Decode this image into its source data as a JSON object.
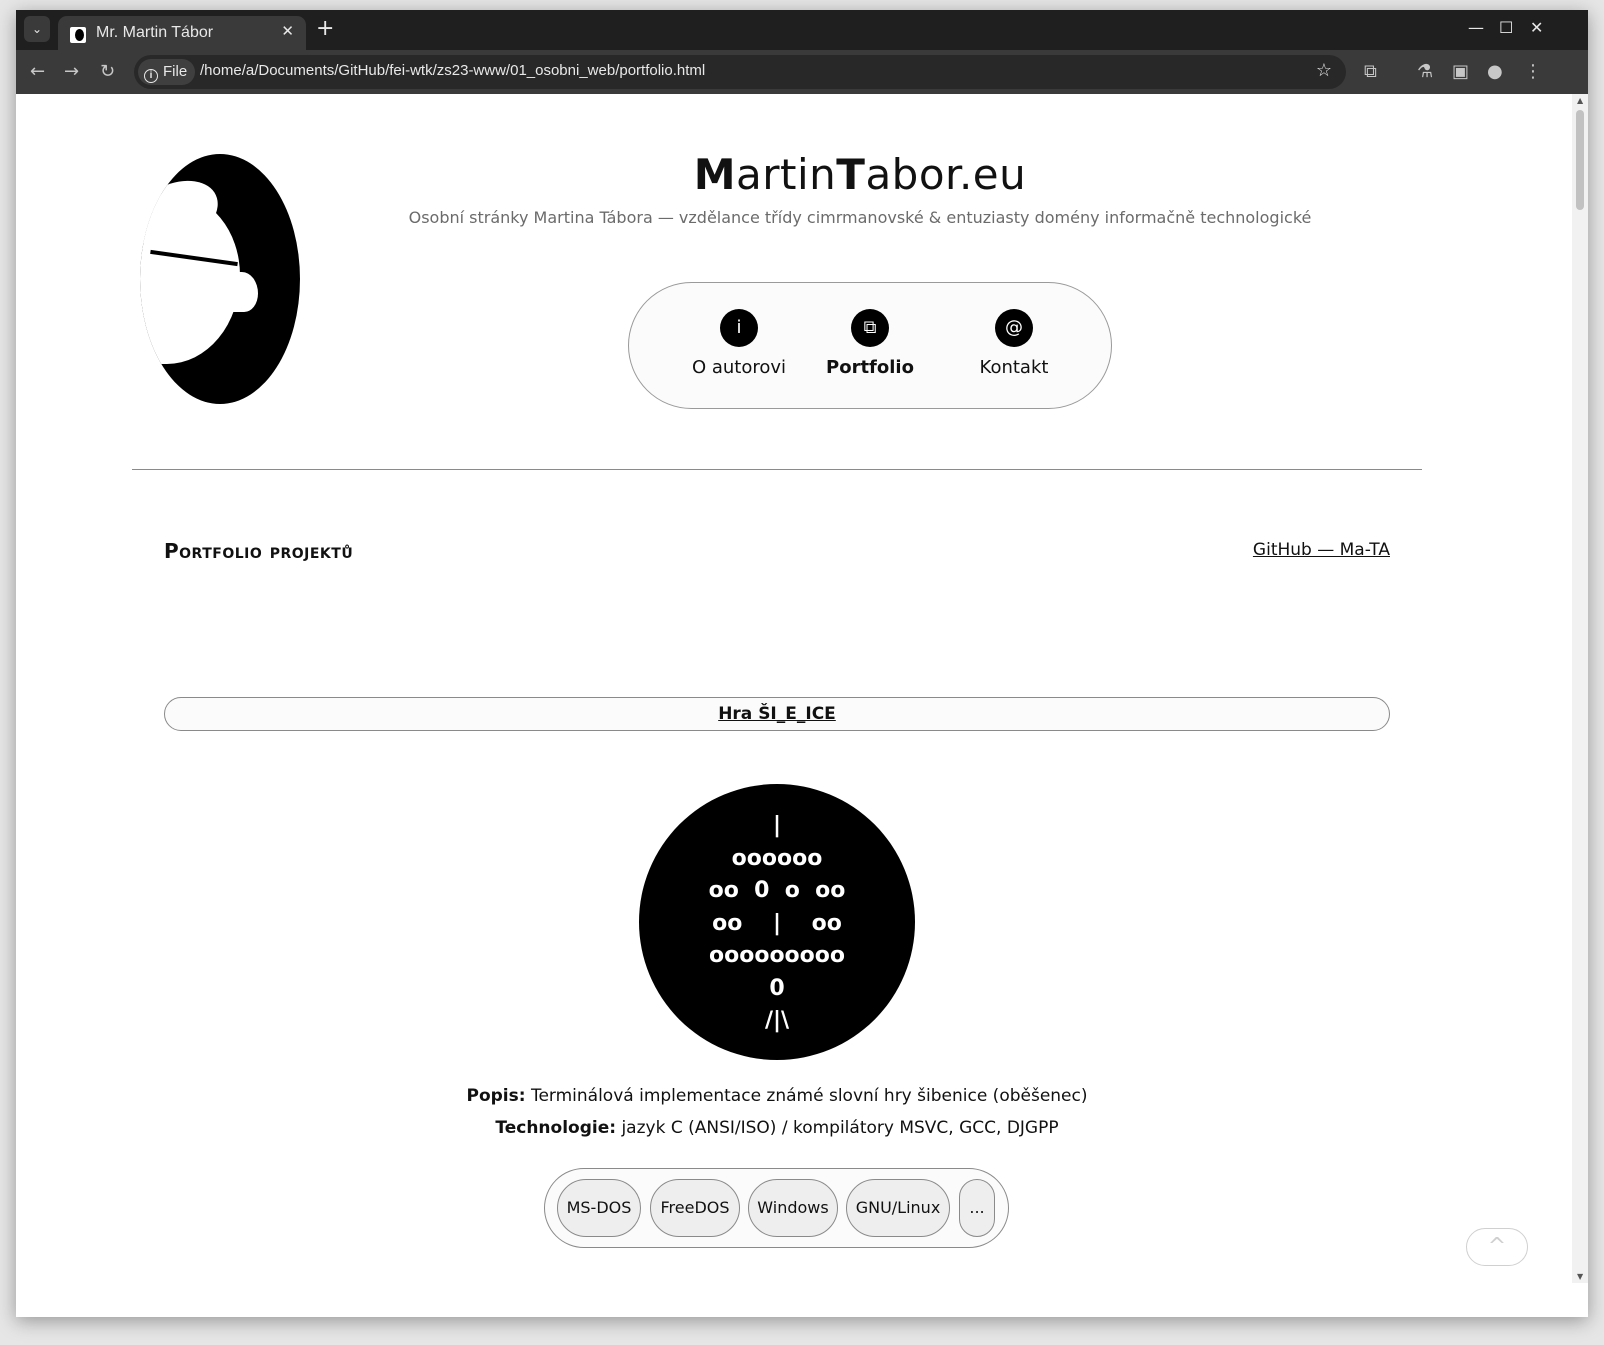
{
  "browser": {
    "tab_title": "Mr. Martin Tábor",
    "new_tab": "+",
    "close_tab": "✕",
    "tab_search": "⌄",
    "window_controls": {
      "minimize": "—",
      "maximize": "☐",
      "close": "✕"
    },
    "omnibox": {
      "chip_icon": "i",
      "chip_label": "File",
      "url": "/home/a/Documents/GitHub/fei-wtk/zs23-www/01_osobni_web/portfolio.html"
    },
    "toolbar_icons": {
      "back": "←",
      "forward": "→",
      "reload": "↻",
      "bookmark": "☆",
      "extensions": "⧉",
      "labs": "⚗",
      "sidepanel": "▣",
      "profile": "●",
      "menu": "⋮"
    }
  },
  "header": {
    "title_part1_bold": "M",
    "title_part1_rest": "artin",
    "title_part2_bold": "T",
    "title_part2_rest": "abor.eu",
    "subtitle": "Osobní stránky Martina Tábora — vzdělance třídy cimrmanovské & entuziasty domény informačně technologické"
  },
  "nav": {
    "items": [
      {
        "icon": "i",
        "label": "O autorovi",
        "active": false
      },
      {
        "icon": "⧉",
        "label": "Portfolio",
        "active": true
      },
      {
        "icon": "@",
        "label": "Kontakt",
        "active": false
      }
    ]
  },
  "portfolio": {
    "section_title": "Portfolio projektů",
    "github_link": "GitHub — Ma-TA",
    "projects": [
      {
        "title": "Hra ŠI_E_ICE",
        "ascii_art": "|\noooooo\noo  0  o  oo\noo    |    oo\nooooooooo\n0\n/|\\",
        "desc_label": "Popis:",
        "desc_text": "Terminálová implementace známé slovní hry šibenice (oběšenec)",
        "tech_label": "Technologie:",
        "tech_text": "jazyk C (ANSI/ISO) / kompilátory MSVC, GCC, DJGPP",
        "platforms": [
          "MS-DOS",
          "FreeDOS",
          "Windows",
          "GNU/Linux",
          "..."
        ]
      }
    ]
  },
  "back_to_top": "^"
}
